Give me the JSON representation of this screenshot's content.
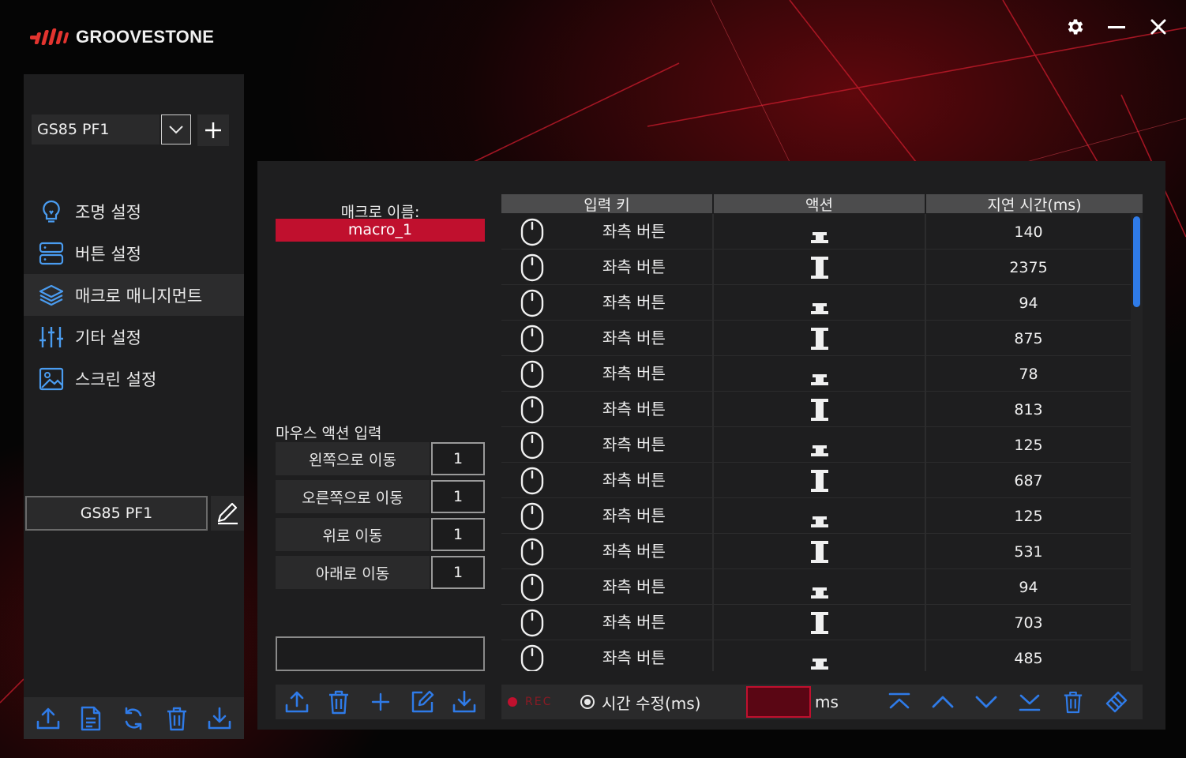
{
  "app": {
    "brand": "GROOVESTONE",
    "accent_color": "#c0102e",
    "highlight_color": "#2f7be8"
  },
  "window_controls": [
    {
      "icon": "gear-icon"
    },
    {
      "icon": "minimize-icon"
    },
    {
      "icon": "close-icon"
    }
  ],
  "sidebar": {
    "profile_select_value": "GS85 PF1",
    "nav_items": [
      {
        "label": "조명 설정",
        "icon": "lightbulb-icon",
        "active": false
      },
      {
        "label": "버튼 설정",
        "icon": "server-icon",
        "active": false
      },
      {
        "label": "매크로 매니지먼트",
        "icon": "layers-icon",
        "active": true
      },
      {
        "label": "기타 설정",
        "icon": "sliders-icon",
        "active": false
      },
      {
        "label": "스크린 설정",
        "icon": "image-icon",
        "active": false
      }
    ],
    "profile_name": "GS85 PF1",
    "toolbar": [
      "upload-icon",
      "file-icon",
      "refresh-icon",
      "trash-icon",
      "download-icon"
    ]
  },
  "macro": {
    "name_label": "매크로 이름:",
    "name_value": "macro_1",
    "mouse_action_title": "마우스 액션 입력",
    "mouse_actions": [
      {
        "label": "왼쪽으로 이동",
        "value": "1"
      },
      {
        "label": "오른쪽으로 이동",
        "value": "1"
      },
      {
        "label": "위로 이동",
        "value": "1"
      },
      {
        "label": "아래로 이동",
        "value": "1"
      }
    ],
    "toolbar": [
      "upload-icon",
      "trash-icon",
      "plus-icon",
      "edit-icon",
      "download-icon"
    ]
  },
  "table": {
    "headers": [
      "입력 키",
      "액션",
      "지연 시간(ms)"
    ],
    "rows": [
      {
        "key": "좌측 버튼",
        "action": "release",
        "delay": "140"
      },
      {
        "key": "좌측 버튼",
        "action": "press",
        "delay": "2375"
      },
      {
        "key": "좌측 버튼",
        "action": "release",
        "delay": "94"
      },
      {
        "key": "좌측 버튼",
        "action": "press",
        "delay": "875"
      },
      {
        "key": "좌측 버튼",
        "action": "release",
        "delay": "78"
      },
      {
        "key": "좌측 버튼",
        "action": "press",
        "delay": "813"
      },
      {
        "key": "좌측 버튼",
        "action": "release",
        "delay": "125"
      },
      {
        "key": "좌측 버튼",
        "action": "press",
        "delay": "687"
      },
      {
        "key": "좌측 버튼",
        "action": "release",
        "delay": "125"
      },
      {
        "key": "좌측 버튼",
        "action": "press",
        "delay": "531"
      },
      {
        "key": "좌측 버튼",
        "action": "release",
        "delay": "94"
      },
      {
        "key": "좌측 버튼",
        "action": "press",
        "delay": "703"
      },
      {
        "key": "좌측 버튼",
        "action": "release",
        "delay": "485"
      }
    ]
  },
  "bottom_bar": {
    "rec_label": "REC",
    "time_edit_label": "시간 수정(ms)",
    "ms_value": "",
    "ms_unit": "ms",
    "nav_buttons": [
      "move-top-icon",
      "move-up-icon",
      "move-down-icon",
      "move-bottom-icon",
      "trash-icon",
      "clear-all-icon"
    ]
  }
}
